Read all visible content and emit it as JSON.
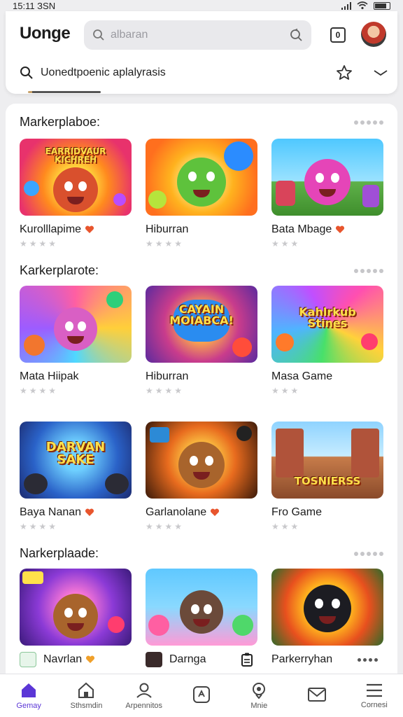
{
  "status_bar": {
    "time": "15:11 ЗSN"
  },
  "header": {
    "app_title": "Uonge",
    "search_placeholder": "albaran",
    "notification_count": "0",
    "subtitle": "Uonedtpoenic aplalyrasis"
  },
  "sections": [
    {
      "title": "Markerplaboe:",
      "items": [
        {
          "label": "Kurolllapime",
          "heart": true,
          "art_text": "EARRIDVAUR\nKICHREH",
          "stars": 4
        },
        {
          "label": "Hiburran",
          "heart": false,
          "art_text": "",
          "stars": 4
        },
        {
          "label": "Bata Mbage",
          "heart": true,
          "art_text": "",
          "stars": 3
        }
      ]
    },
    {
      "title": "Karkerplarote:",
      "items": [
        {
          "label": "Mata Hiipak",
          "heart": false,
          "art_text": "",
          "stars": 4
        },
        {
          "label": "Hiburran",
          "heart": false,
          "art_text": "CAYAIN\nMOIABCA!",
          "stars": 4
        },
        {
          "label": "Masa Game",
          "heart": false,
          "art_text": "Kahlrkub\nStines",
          "stars": 3
        }
      ]
    },
    {
      "title": "",
      "items": [
        {
          "label": "Baya Nanan",
          "heart": true,
          "art_text": "DARVAN\nSAKE",
          "stars": 4
        },
        {
          "label": "Garlanolane",
          "heart": true,
          "art_text": "",
          "stars": 4
        },
        {
          "label": "Fro Game",
          "heart": false,
          "art_text": "TOSNIERSS",
          "stars": 3
        }
      ]
    },
    {
      "title": "Narkerplaade:",
      "items": [
        {
          "label": "Navrlan",
          "heart": true,
          "art_text": "",
          "stars": 0
        },
        {
          "label": "Darnga",
          "heart": false,
          "art_text": "",
          "stars": 0
        },
        {
          "label": "Parkerryhan",
          "heart": false,
          "art_text": "",
          "stars": 0
        }
      ]
    }
  ],
  "bottom_nav": [
    {
      "label": "Gemay",
      "icon": "home-filled-icon",
      "active": true
    },
    {
      "label": "Sthsmdin",
      "icon": "home-outline-icon",
      "active": false
    },
    {
      "label": "Arpennitos",
      "icon": "person-icon",
      "active": false
    },
    {
      "label": "",
      "icon": "app-box-icon",
      "active": false
    },
    {
      "label": "Mnie",
      "icon": "pin-icon",
      "active": false
    },
    {
      "label": "",
      "icon": "mail-icon",
      "active": false
    },
    {
      "label": "Cornesi",
      "icon": "menu-icon",
      "active": false
    }
  ],
  "colors": {
    "accent": "#5b36d6",
    "heart": "#e8552d"
  }
}
